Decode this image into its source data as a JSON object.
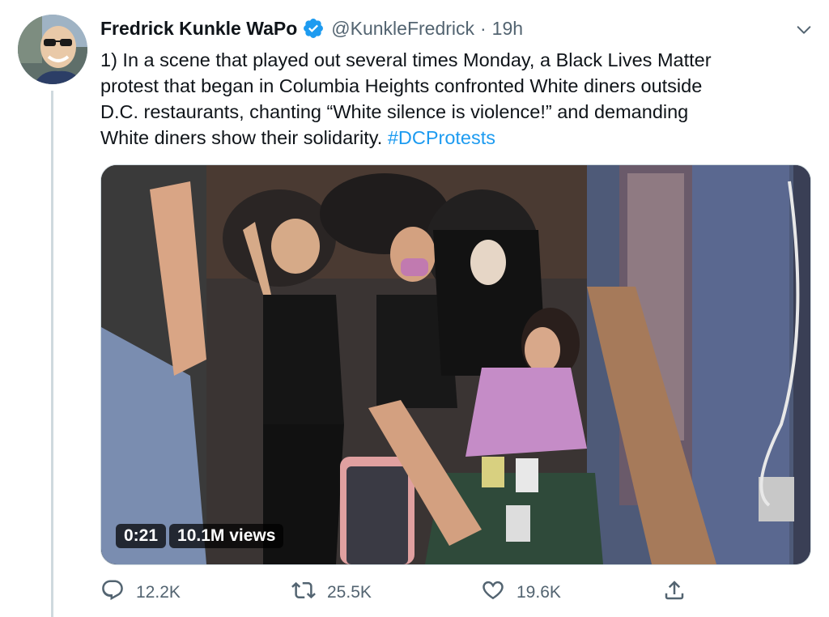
{
  "author": {
    "display_name": "Fredrick Kunkle WaPo",
    "handle": "@KunkleFredrick",
    "separator": "·",
    "time": "19h",
    "verified_icon": "verified-badge-icon"
  },
  "tweet": {
    "lines": [
      "1) In a scene that played out several times Monday, a Black Lives Matter",
      "protest that began in Columbia Heights confronted White diners outside",
      "D.C. restaurants,  chanting “White silence is violence!” and demanding"
    ],
    "last_line_prefix": "White diners show their solidarity. ",
    "hashtag": "#DCProtests"
  },
  "video": {
    "time": "0:21",
    "views": "10.1M views"
  },
  "actions": {
    "reply_count": "12.2K",
    "retweet_count": "25.5K",
    "like_count": "19.6K"
  },
  "colors": {
    "link": "#1d9bf0",
    "verified": "#1d9bf0",
    "secondary_text": "#536471"
  }
}
